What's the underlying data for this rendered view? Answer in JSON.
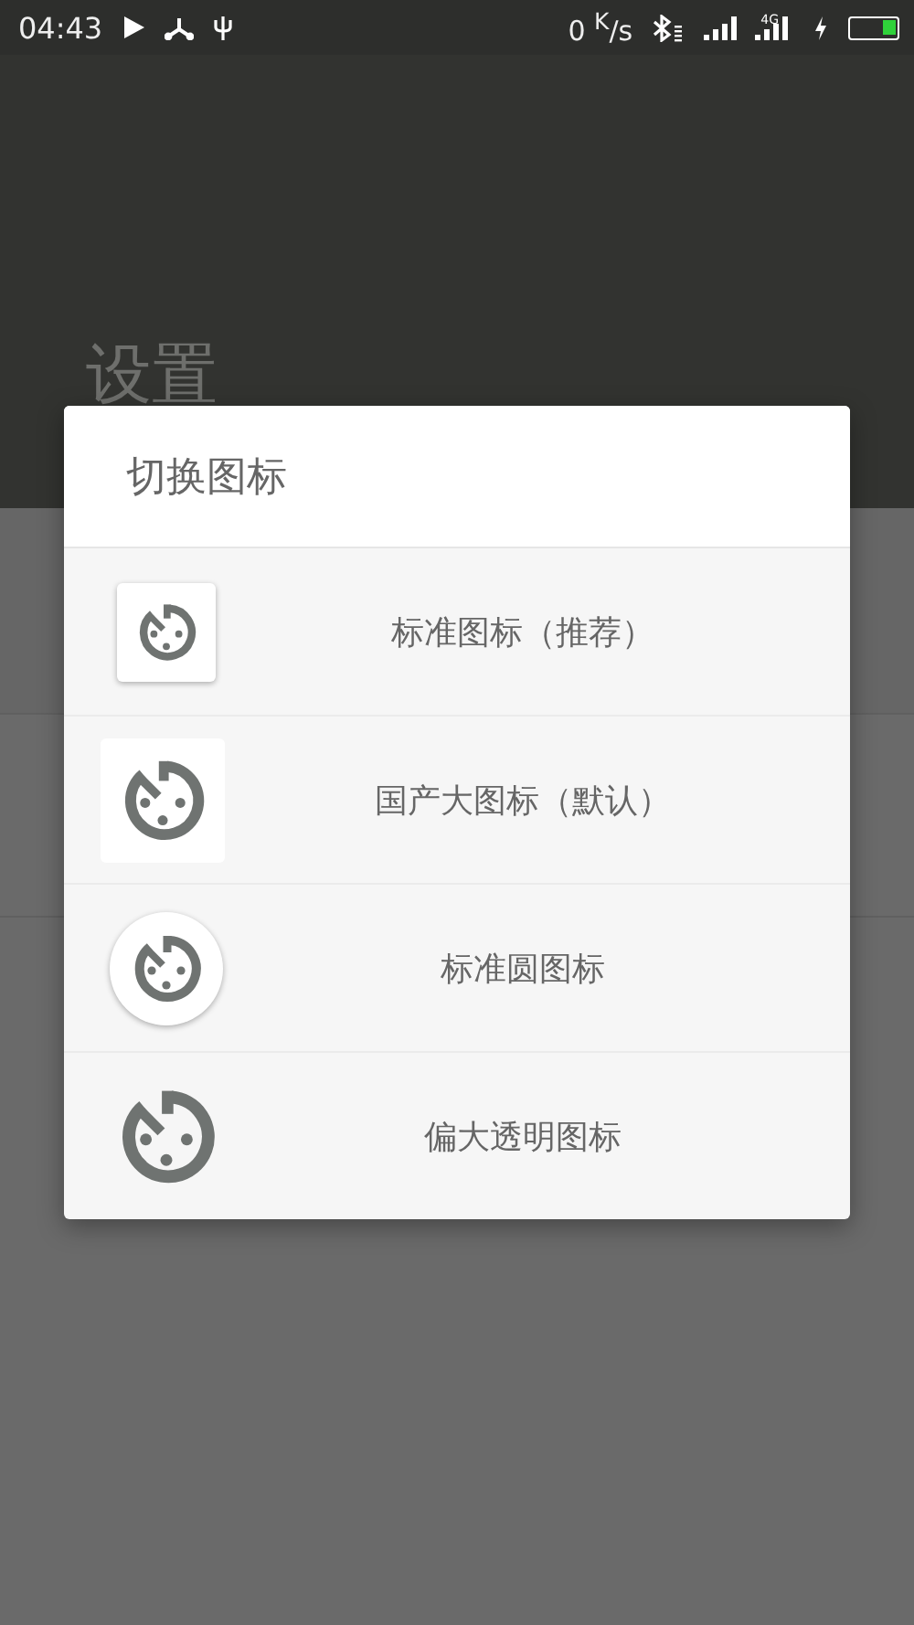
{
  "status_bar": {
    "time": "04:43",
    "speed": "0 $^{K}$/s",
    "network_label": "4G",
    "battery": {
      "level": 0.3
    }
  },
  "page": {
    "title": "设置"
  },
  "dialog": {
    "title": "切换图标",
    "options": [
      {
        "kind": "rounded-square",
        "label": "标准图标（推荐）"
      },
      {
        "kind": "large-square",
        "label": "国产大图标（默认）"
      },
      {
        "kind": "circle",
        "label": "标准圆图标"
      },
      {
        "kind": "plain",
        "label": "偏大透明图标"
      }
    ]
  }
}
